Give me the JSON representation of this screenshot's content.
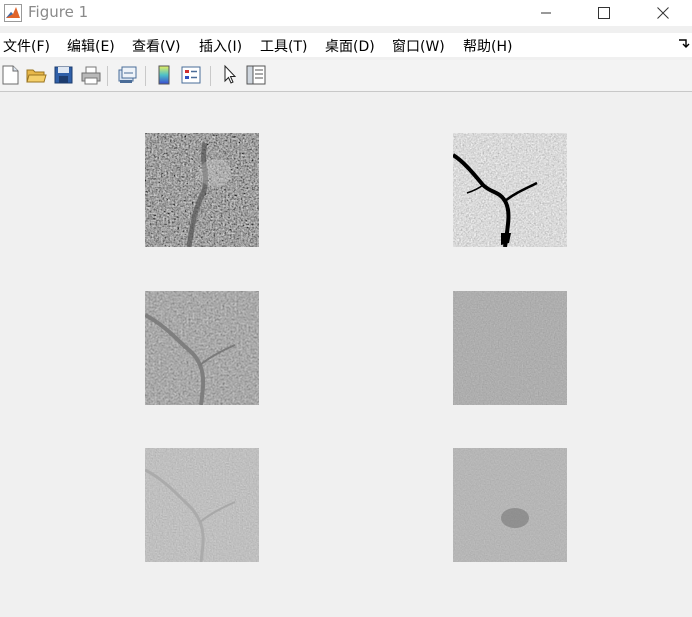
{
  "window": {
    "title": "Figure 1",
    "app_icon": "matlab-icon",
    "controls": [
      "minimize-icon",
      "maximize-icon",
      "close-icon"
    ]
  },
  "menubar": {
    "items": [
      {
        "label": "文件(F)"
      },
      {
        "label": "编辑(E)"
      },
      {
        "label": "查看(V)"
      },
      {
        "label": "插入(I)"
      },
      {
        "label": "工具(T)"
      },
      {
        "label": "桌面(D)"
      },
      {
        "label": "窗口(W)"
      },
      {
        "label": "帮助(H)"
      }
    ],
    "dock_icon": "dock-arrow-icon"
  },
  "toolbar": {
    "icons": [
      "new-figure-icon",
      "open-file-icon",
      "save-icon",
      "print-icon",
      "link-plot-icon",
      "insert-colorbar-icon",
      "insert-legend-icon",
      "edit-plot-pointer-icon",
      "property-inspector-icon"
    ]
  },
  "figure": {
    "subplots": [
      {
        "style": "dark-urban"
      },
      {
        "style": "bright-river"
      },
      {
        "style": "mid-gray-river"
      },
      {
        "style": "flat-gray"
      },
      {
        "style": "light-gray-river"
      },
      {
        "style": "flat-gray-faint"
      }
    ]
  },
  "colors": {
    "window_bg": "#f0f0f0",
    "titlebar_bg": "#ffffff",
    "title_text": "#8a8a8a",
    "toolbar_border": "#c8c8c8"
  }
}
